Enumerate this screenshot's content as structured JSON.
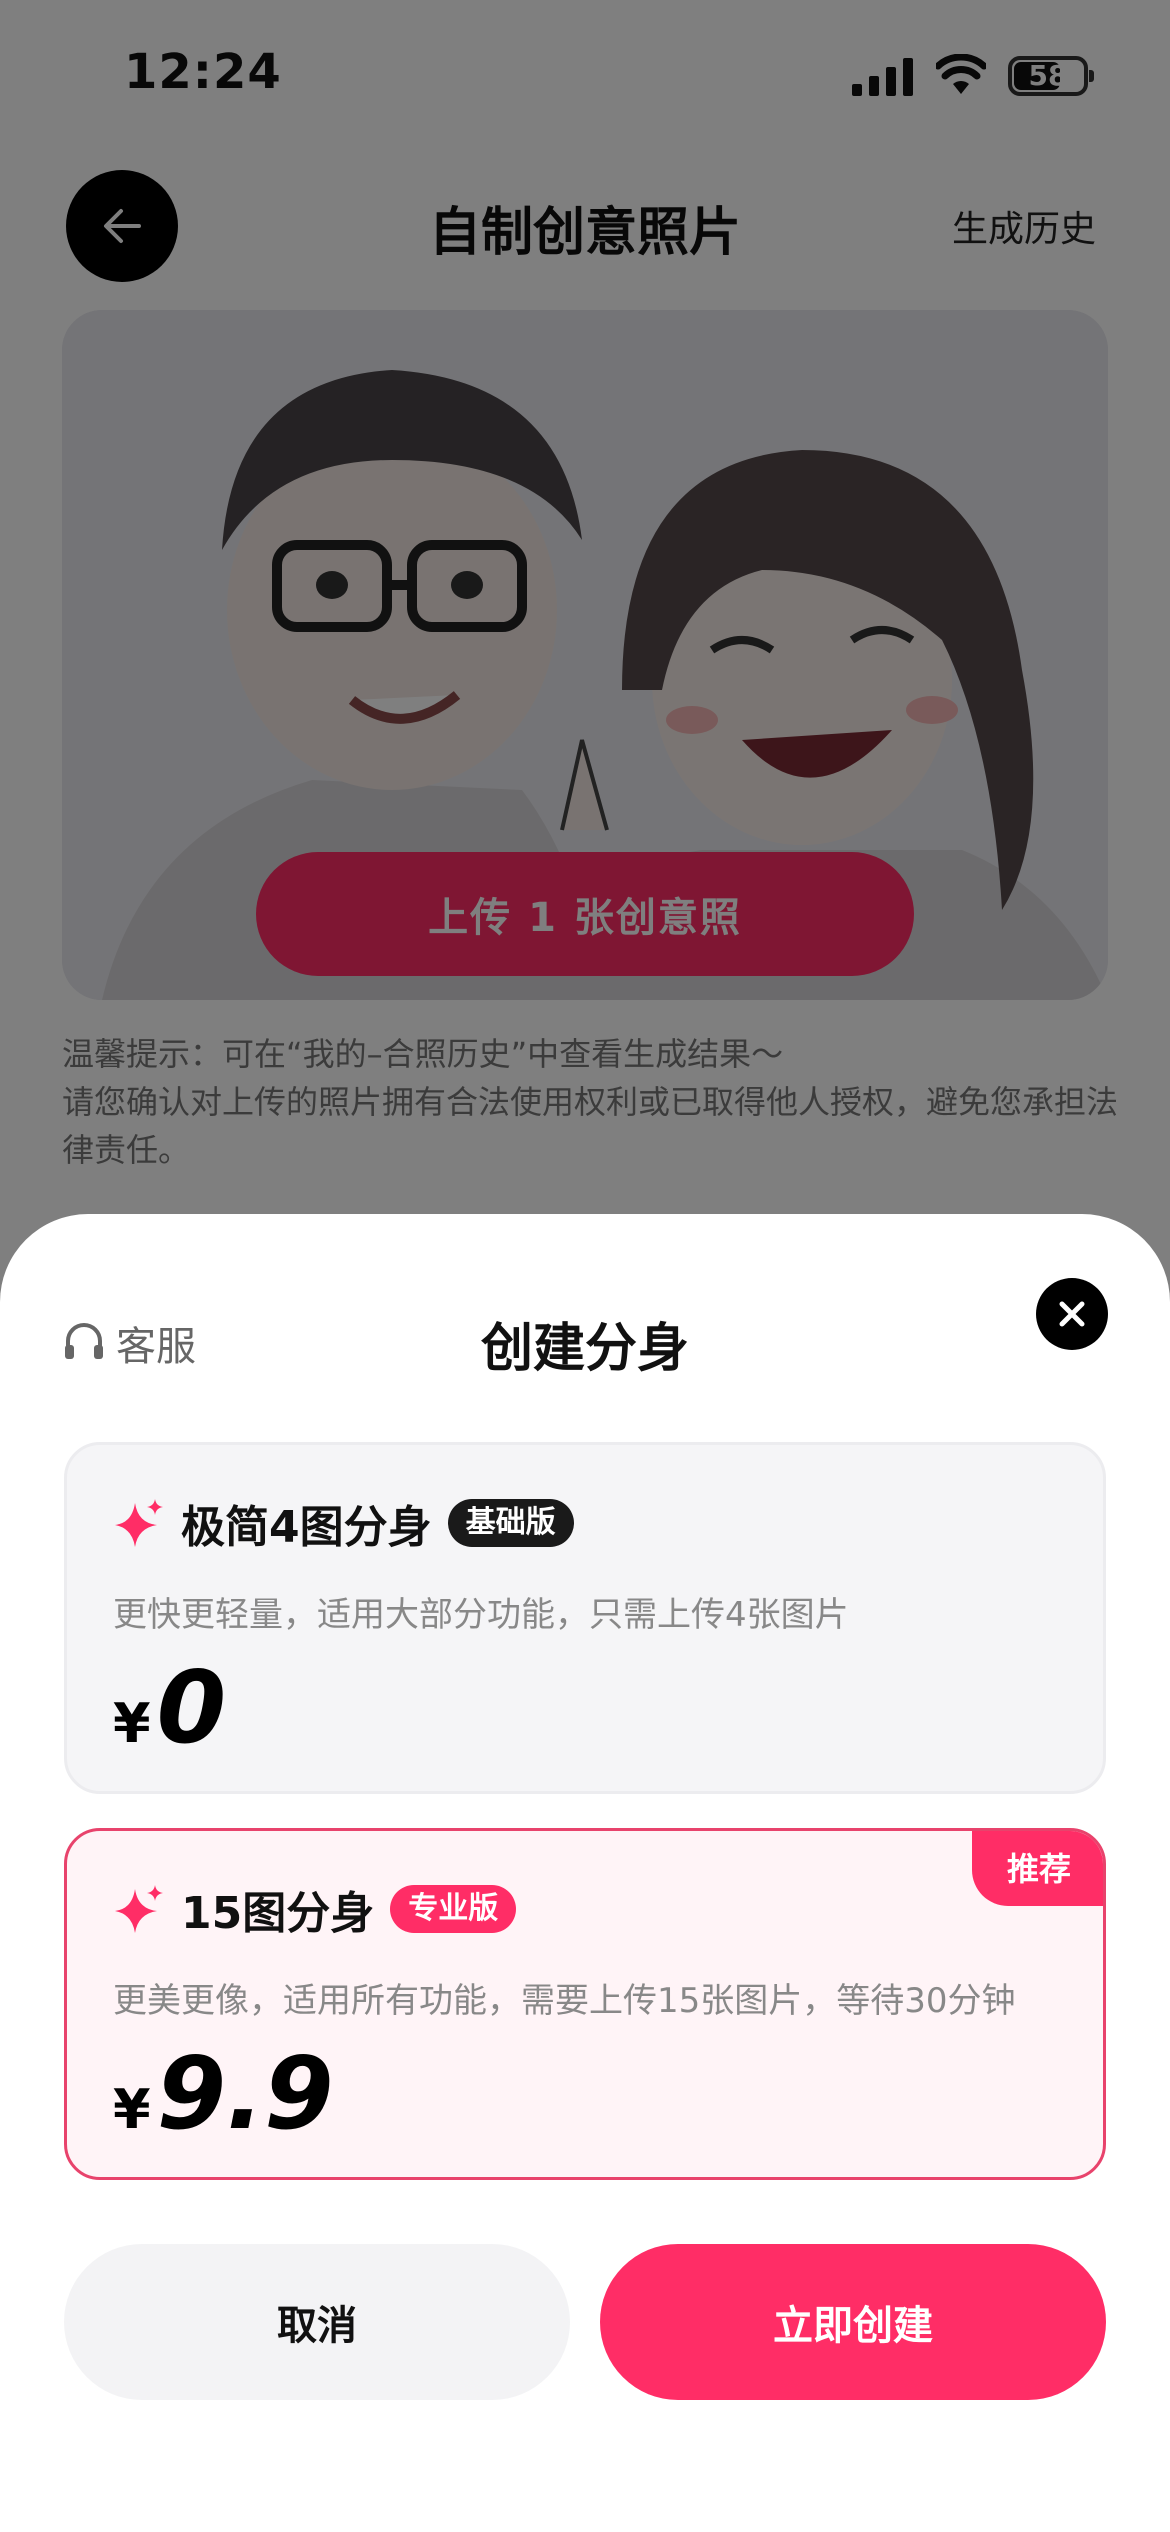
{
  "status_bar": {
    "time": "12:24",
    "battery": "58"
  },
  "header": {
    "title": "自制创意照片",
    "history": "生成历史"
  },
  "upload": {
    "button_label": "上传 1 张创意照"
  },
  "tips": {
    "line1": "温馨提示：可在“我的–合照历史”中查看生成结果～",
    "line2": "请您确认对上传的照片拥有合法使用权利或已取得他人授权，避免您承担法律责任。"
  },
  "sheet": {
    "service_label": "客服",
    "title": "创建分身",
    "plans": [
      {
        "name": "极简4图分身",
        "badge": "基础版",
        "desc": "更快更轻量，适用大部分功能，只需上传4张图片",
        "currency": "¥",
        "price": "0"
      },
      {
        "name": "15图分身",
        "badge": "专业版",
        "desc": "更美更像，适用所有功能，需要上传15张图片，等待30分钟",
        "currency": "¥",
        "price": "9.9",
        "tag": "推荐"
      }
    ],
    "cancel_label": "取消",
    "create_label": "立即创建"
  },
  "colors": {
    "accent": "#ff2d66",
    "dark": "#111111",
    "muted": "#888888"
  },
  "icons": [
    "signal-icon",
    "wifi-icon",
    "battery-icon",
    "arrow-left-icon",
    "headset-icon",
    "close-icon",
    "sparkle-icon"
  ]
}
